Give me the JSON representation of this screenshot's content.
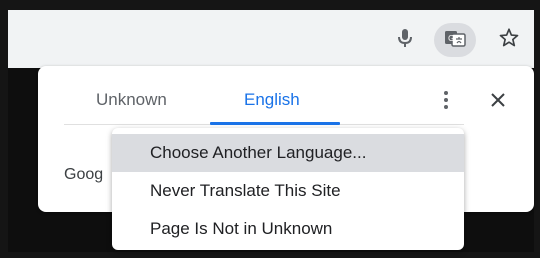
{
  "popup": {
    "tabs": [
      {
        "label": "Unknown"
      },
      {
        "label": "English"
      }
    ],
    "partial_left_glyph": "G",
    "body_text_partial": "Goog"
  },
  "menu": {
    "items": [
      {
        "label": "Choose Another Language..."
      },
      {
        "label": "Never Translate This Site"
      },
      {
        "label": "Page Is Not in Unknown"
      }
    ]
  },
  "toolbar": {
    "icons": [
      "microphone-icon",
      "translate-icon",
      "star-icon"
    ]
  },
  "colors": {
    "accent": "#1a73e8",
    "toolbar_bg": "#f1f3f4",
    "page_bg": "#0e0e0e",
    "menu_highlight": "#dadce0"
  }
}
